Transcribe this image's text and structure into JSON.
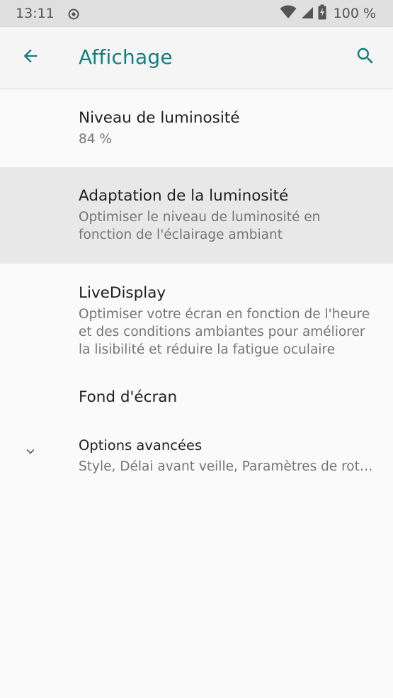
{
  "status_bar": {
    "time": "13:11",
    "battery_text": "100 %",
    "icons": [
      "sync-circle-icon",
      "wifi-icon",
      "cellular-signal-icon",
      "battery-charging-icon"
    ]
  },
  "app_bar": {
    "title": "Affichage",
    "back_icon": "arrow-back-icon",
    "search_icon": "search-icon"
  },
  "colors": {
    "accent": "#137f80",
    "highlight_row": "#e8e8e8",
    "background": "#fafafa",
    "status_bar": "#e0e0e0"
  },
  "settings": [
    {
      "title": "Niveau de luminosité",
      "summary": "84 %"
    },
    {
      "title": "Adaptation de la luminosité",
      "summary": "Optimiser le niveau de luminosité en fonction de l'éclairage ambiant"
    },
    {
      "title": "LiveDisplay",
      "summary": "Optimiser votre écran en fonction de l'heure et des conditions ambiantes pour améliorer la lisibilité et réduire la fatigue oculaire"
    },
    {
      "title": "Fond d'écran"
    },
    {
      "title": "Options avancées",
      "summary": "Style, Délai avant veille, Paramètres de rotation",
      "icon": "chevron-down-icon"
    }
  ]
}
